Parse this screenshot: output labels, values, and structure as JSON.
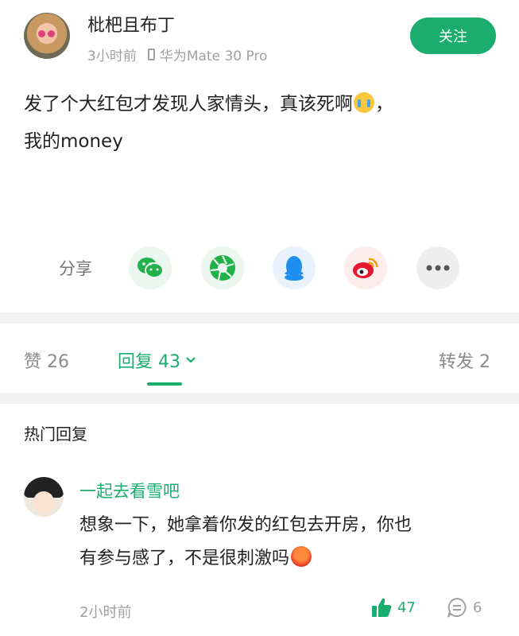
{
  "post": {
    "author": "枇杷且布丁",
    "time": "3小时前",
    "device": "华为Mate 30 Pro",
    "follow_label": "关注",
    "text_line1": "发了个大红包才发现人家情头，真该死啊",
    "text_line1_tail": "，",
    "text_line2": "我的money",
    "emoji": "cry-emoji"
  },
  "share": {
    "label": "分享",
    "targets": [
      "wechat-icon",
      "moments-icon",
      "qq-icon",
      "weibo-icon",
      "more-icon"
    ]
  },
  "tabs": {
    "likes": "赞 26",
    "replies": "回复 43",
    "reposts": "转发 2"
  },
  "hot_replies": {
    "title": "热门回复",
    "comment": {
      "author": "一起去看雪吧",
      "text_line1": "想象一下，她拿着你发的红包去开房，你也",
      "text_line2": "有参与感了，不是很刺激吗",
      "emoji": "angry-emoji",
      "time": "2小时前",
      "likes": "47",
      "replies": "6"
    }
  },
  "colors": {
    "accent": "#1aad6d",
    "muted": "#a0a0a0",
    "divider": "#f2f2f2"
  }
}
